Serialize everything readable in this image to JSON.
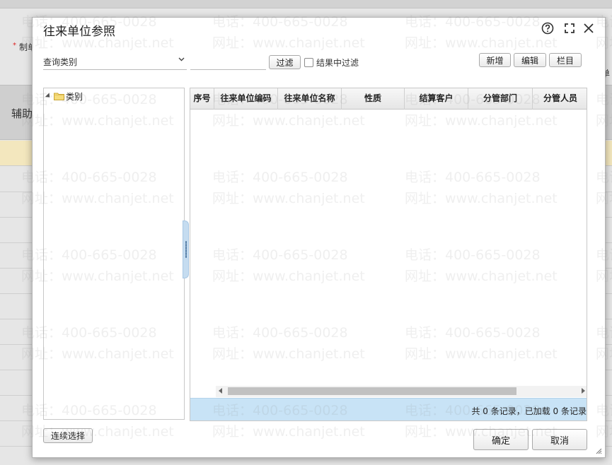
{
  "background": {
    "required_mark": "*",
    "field_label": "制单",
    "aux_label": "辅助",
    "right_text": "单"
  },
  "dialog": {
    "title": "往来单位参照",
    "query_select": {
      "value": "查询类别"
    },
    "filter_input": {
      "value": "",
      "placeholder": ""
    },
    "filter_button": "过滤",
    "filter_in_results": {
      "label": "结果中过滤",
      "checked": false
    },
    "toolbar": {
      "add": "新增",
      "edit": "编辑",
      "columns": "栏目"
    },
    "tree": {
      "root_label": "类别"
    },
    "grid": {
      "columns": [
        "序号",
        "往来单位编码",
        "往来单位名称",
        "性质",
        "结算客户",
        "分管部门",
        "分管人员"
      ],
      "rows": [],
      "footer": "共 0 条记录，已加载 0 条记录"
    },
    "continuous_select": "连续选择",
    "ok": "确定",
    "cancel": "取消"
  },
  "watermark": {
    "phone": "电话：400-665-0028",
    "site": "网址：www.chanjet.net"
  },
  "icons": [
    "help-icon",
    "maximize-icon",
    "close-icon",
    "chevron-down-icon",
    "folder-icon",
    "tree-caret-icon",
    "resize-grip-icon"
  ],
  "colors": {
    "footer_bg": "#c8e3f6",
    "splitter": "#c5dcf0",
    "highlight_row": "#f3e7be"
  }
}
